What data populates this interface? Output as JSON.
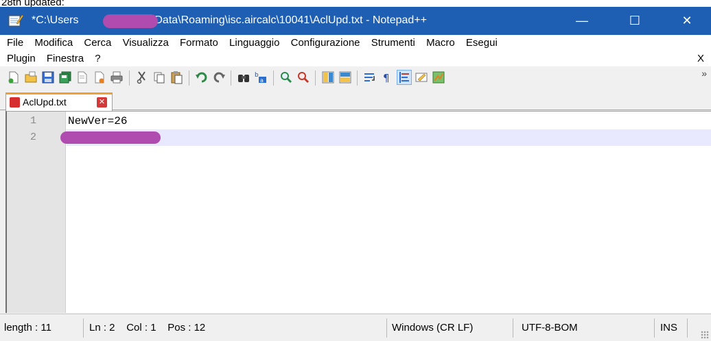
{
  "caption": "28th updated:",
  "window": {
    "title": "*C:\\Users\\AppData\\Roaming\\isc.aircalc\\10041\\AclUpd.txt - Notepad++",
    "title_prefix": "*C:\\Users",
    "title_suffix": "\\AppData\\Roaming\\isc.aircalc\\10041\\AclUpd.txt - Notepad++",
    "minimize": "—",
    "maximize": "☐",
    "close": "✕"
  },
  "menu": {
    "items": [
      "File",
      "Modifica",
      "Cerca",
      "Visualizza",
      "Formato",
      "Linguaggio",
      "Configurazione",
      "Strumenti",
      "Macro",
      "Esegui",
      "Plugin",
      "Finestra",
      "?"
    ],
    "close_x": "X"
  },
  "toolbar": {
    "icons": [
      "new-file-icon",
      "open-file-icon",
      "save-icon",
      "save-all-icon",
      "close-icon",
      "close-all-icon",
      "print-icon",
      "cut-icon",
      "copy-icon",
      "paste-icon",
      "undo-icon",
      "redo-icon",
      "find-icon",
      "replace-icon",
      "zoom-in-icon",
      "zoom-out-icon",
      "sync-vertical-icon",
      "sync-horizontal-icon",
      "word-wrap-icon",
      "show-all-chars-icon",
      "indent-guide-icon",
      "udl-icon",
      "doc-map-icon"
    ],
    "overflow": "»"
  },
  "tab": {
    "label": "AclUpd.txt",
    "close": "✕"
  },
  "editor": {
    "lines": [
      {
        "number": "1",
        "text": "NewVer=26"
      },
      {
        "number": "2",
        "text": ""
      }
    ],
    "current_line_color": "#e8e8ff"
  },
  "status": {
    "length": "length : 11",
    "position": "Ln : 2    Col : 1    Pos : 12",
    "eol": "Windows (CR LF)",
    "encoding": "UTF-8-BOM",
    "mode": "INS"
  },
  "colors": {
    "titlebar": "#1f5fb3",
    "tab_accent": "#f0a030",
    "redaction": "#b04cb0"
  }
}
